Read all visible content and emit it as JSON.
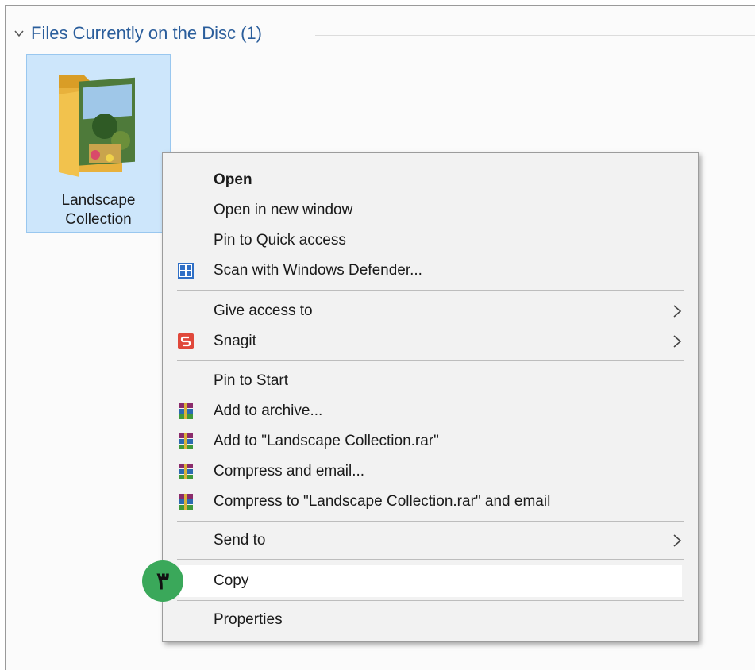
{
  "group": {
    "title": "Files Currently on the Disc (1)"
  },
  "folder": {
    "name_line1": "Landscape",
    "name_line2": "Collection"
  },
  "context_menu": {
    "items": [
      {
        "label": "Open",
        "bold": true
      },
      {
        "label": "Open in new window"
      },
      {
        "label": "Pin to Quick access"
      },
      {
        "label": "Scan with Windows Defender...",
        "icon": "windows-defender-icon"
      },
      {
        "label": "Give access to",
        "submenu": true
      },
      {
        "label": "Snagit",
        "icon": "snagit-icon",
        "submenu": true
      },
      {
        "label": "Pin to Start"
      },
      {
        "label": "Add to archive...",
        "icon": "winrar-icon"
      },
      {
        "label": "Add to \"Landscape Collection.rar\"",
        "icon": "winrar-icon"
      },
      {
        "label": "Compress and email...",
        "icon": "winrar-icon"
      },
      {
        "label": "Compress to \"Landscape Collection.rar\" and email",
        "icon": "winrar-icon"
      },
      {
        "label": "Send to",
        "submenu": true
      },
      {
        "label": "Copy",
        "highlighted": true
      },
      {
        "label": "Properties"
      }
    ]
  },
  "step_badge": "٣",
  "colors": {
    "header_blue": "#2a5d9b",
    "selection_bg": "#cde6fb",
    "badge_green": "#3aa85a",
    "snagit_red": "#e0483b"
  }
}
